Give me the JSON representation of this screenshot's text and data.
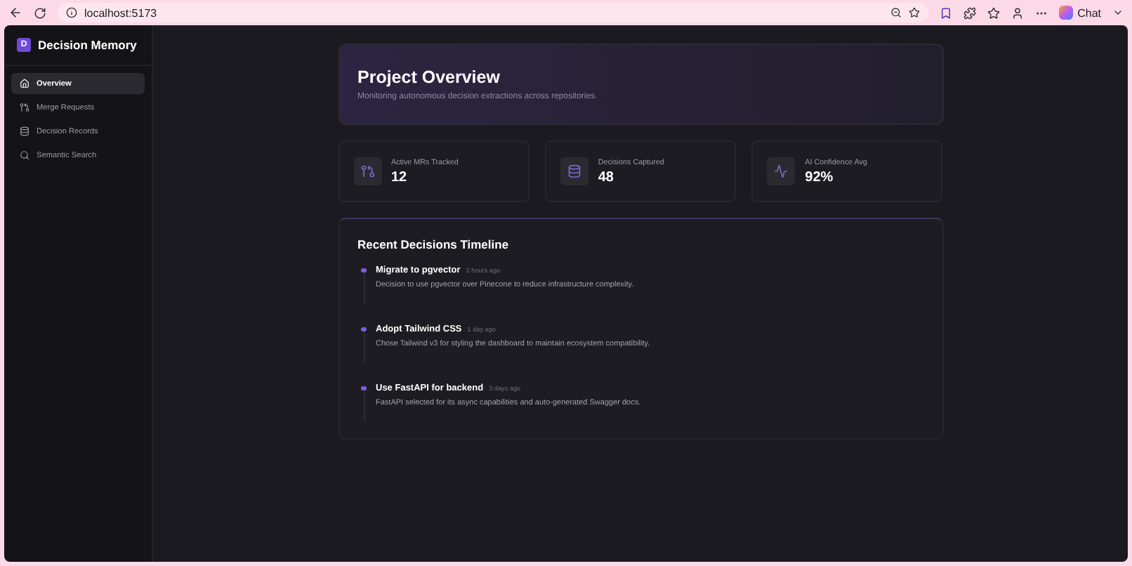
{
  "browser": {
    "url": "localhost:5173",
    "chat_label": "Chat"
  },
  "sidebar": {
    "brand_letter": "D",
    "brand": "Decision Memory",
    "items": [
      {
        "label": "Overview",
        "selected": true
      },
      {
        "label": "Merge Requests",
        "selected": false
      },
      {
        "label": "Decision Records",
        "selected": false
      },
      {
        "label": "Semantic Search",
        "selected": false
      }
    ]
  },
  "header": {
    "title": "Project Overview",
    "subtitle": "Monitoring autonomous decision extractions across repositories."
  },
  "stats": [
    {
      "label": "Active MRs Tracked",
      "value": "12"
    },
    {
      "label": "Decisions Captured",
      "value": "48"
    },
    {
      "label": "AI Confidence Avg",
      "value": "92%"
    }
  ],
  "timeline": {
    "title": "Recent Decisions Timeline",
    "items": [
      {
        "title": "Migrate to pgvector",
        "time": "2 hours ago",
        "description": "Decision to use pgvector over Pinecone to reduce infrastructure complexity."
      },
      {
        "title": "Adopt Tailwind CSS",
        "time": "1 day ago",
        "description": "Chose Tailwind v3 for styling the dashboard to maintain ecosystem compatibility."
      },
      {
        "title": "Use FastAPI for backend",
        "time": "3 days ago",
        "description": "FastAPI selected for its async capabilities and auto-generated Swagger docs."
      }
    ]
  }
}
